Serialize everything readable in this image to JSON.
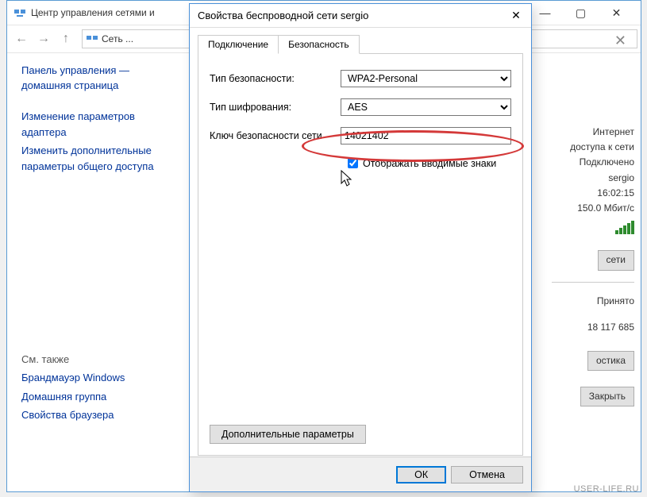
{
  "parent_window": {
    "title": "Центр управления сетями и",
    "breadcrumb_label": "Сеть ..."
  },
  "sidebar": {
    "head1": "Панель управления —",
    "head2": "домашняя страница",
    "link_adapter": "Изменение параметров адаптера",
    "link_sharing": "Изменить дополнительные параметры общего доступа",
    "section_also": "См. также",
    "link_firewall": "Брандмауэр Windows",
    "link_homegroup": "Домашняя группа",
    "link_browser": "Свойства браузера"
  },
  "right_panel": {
    "internet": "Интернет",
    "access": "доступа к сети",
    "state": "Подключено",
    "ssid": "sergio",
    "duration": "16:02:15",
    "speed": "150.0 Мбит/с",
    "btn_net": "сети",
    "received_label": "Принято",
    "received_value": "18 117 685",
    "btn_diag": "остика",
    "btn_close": "Закрыть"
  },
  "dialog": {
    "title": "Свойства беспроводной сети sergio",
    "tab_connection": "Подключение",
    "tab_security": "Безопасность",
    "field_sec_type": "Тип безопасности:",
    "field_enc_type": "Тип шифрования:",
    "field_key": "Ключ безопасности сети",
    "value_sec_type": "WPA2-Personal",
    "value_enc_type": "AES",
    "value_key": "14021402",
    "checkbox_show": "Отображать вводимые знаки",
    "btn_advanced": "Дополнительные параметры",
    "btn_ok": "ОК",
    "btn_cancel": "Отмена"
  },
  "watermark": "USER-LIFE.RU"
}
